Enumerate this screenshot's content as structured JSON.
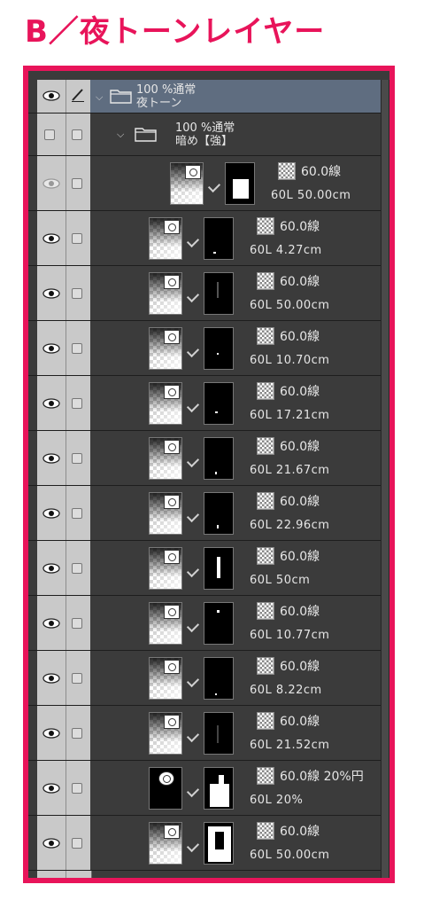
{
  "heading": "B／夜トーンレイヤー",
  "group1": {
    "opacity_blend": "100 %通常",
    "name": "夜トーン"
  },
  "group2": {
    "opacity_blend": "100 %通常",
    "name": "暗め【強】"
  },
  "layers": [
    {
      "tone": "60.0線",
      "info": "60L 50.00cm"
    },
    {
      "tone": "60.0線",
      "info": "60L 4.27cm"
    },
    {
      "tone": "60.0線",
      "info": "60L 50.00cm"
    },
    {
      "tone": "60.0線",
      "info": "60L 10.70cm"
    },
    {
      "tone": "60.0線",
      "info": "60L 17.21cm"
    },
    {
      "tone": "60.0線",
      "info": "60L 21.67cm"
    },
    {
      "tone": "60.0線",
      "info": "60L 22.96cm"
    },
    {
      "tone": "60.0線",
      "info": "60L 50cm"
    },
    {
      "tone": "60.0線",
      "info": "60L 10.77cm"
    },
    {
      "tone": "60.0線",
      "info": "60L 8.22cm"
    },
    {
      "tone": "60.0線",
      "info": "60L 21.52cm"
    },
    {
      "tone": "60.0線 20%円",
      "info": "60L 20%"
    },
    {
      "tone": "60.0線",
      "info": "60L 50.00cm"
    }
  ],
  "colors": {
    "accent": "#e8145a",
    "panel": "#3b3b3b",
    "selected": "#5f6d80",
    "visibility_column": "#c9c9c9"
  },
  "icons": {
    "visibility": "eye-icon",
    "lock": "lock-checkbox-icon",
    "pen": "pen-icon",
    "folder": "folder-icon",
    "expand": "chevron-down-icon",
    "tone": "checker-tone-icon",
    "mask": "layer-mask-icon"
  }
}
